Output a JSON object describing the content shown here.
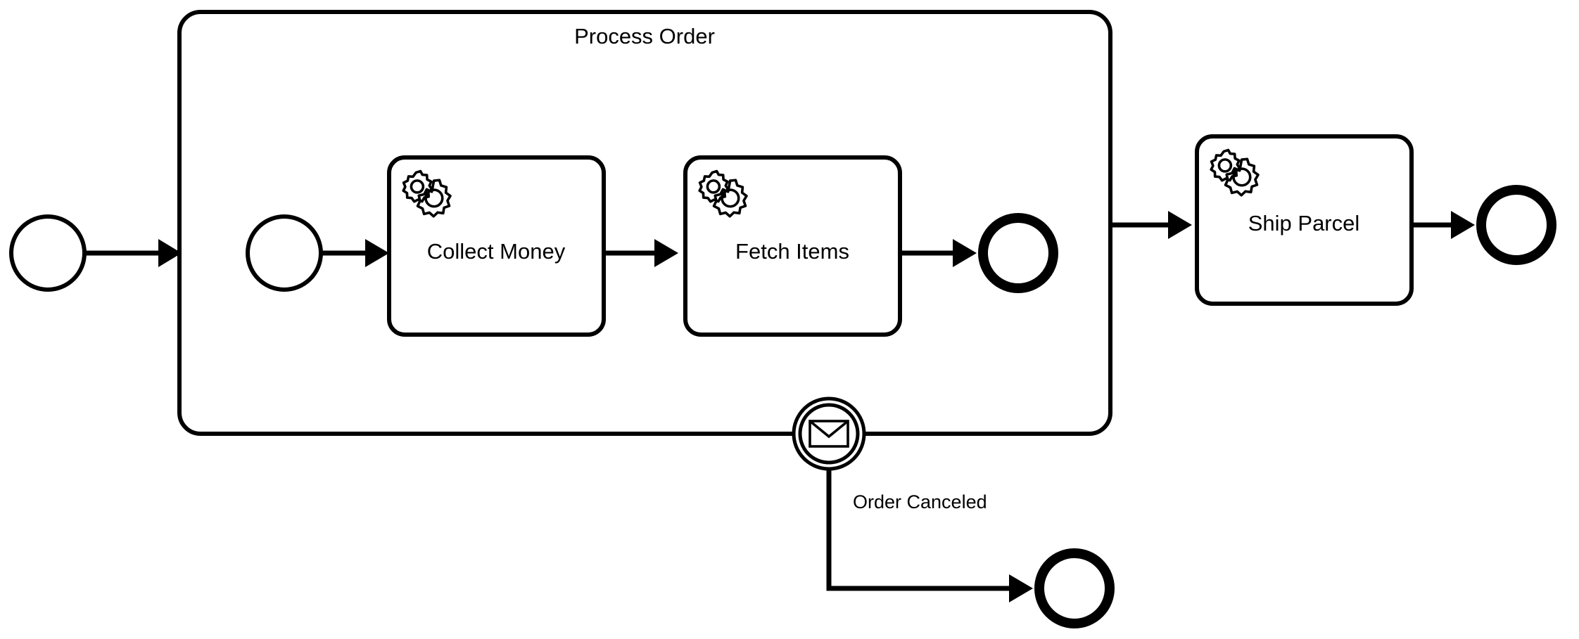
{
  "diagram": {
    "type": "bpmn-process",
    "title": "Process Order",
    "background_color": "#ffffff",
    "stroke_color": "#000000"
  },
  "subprocess": {
    "name": "Process Order",
    "label": "Process Order",
    "kind": "expanded-subprocess"
  },
  "events": {
    "outer_start": {
      "label": "",
      "kind": "start-event"
    },
    "inner_start": {
      "label": "",
      "kind": "start-event"
    },
    "inner_end": {
      "label": "",
      "kind": "end-event"
    },
    "outer_end": {
      "label": "",
      "kind": "end-event"
    },
    "canceled_end": {
      "label": "",
      "kind": "end-event"
    },
    "boundary_message": {
      "label": "Order Canceled",
      "kind": "boundary-message-event",
      "icon": "envelope-icon"
    }
  },
  "tasks": [
    {
      "id": "collect-money",
      "label": "Collect Money",
      "kind": "service-task",
      "icon": "gear-icon"
    },
    {
      "id": "fetch-items",
      "label": "Fetch Items",
      "kind": "service-task",
      "icon": "gear-icon"
    },
    {
      "id": "ship-parcel",
      "label": "Ship Parcel",
      "kind": "service-task",
      "icon": "gear-icon"
    }
  ],
  "flows": [
    {
      "id": "flow-start-to-subprocess",
      "label": ""
    },
    {
      "id": "flow-innerstart-to-collect",
      "label": ""
    },
    {
      "id": "flow-collect-to-fetch",
      "label": ""
    },
    {
      "id": "flow-fetch-to-innerend",
      "label": ""
    },
    {
      "id": "flow-subprocess-to-ship",
      "label": ""
    },
    {
      "id": "flow-ship-to-end",
      "label": ""
    },
    {
      "id": "flow-boundary-to-canceled",
      "label": "Order Canceled"
    }
  ]
}
